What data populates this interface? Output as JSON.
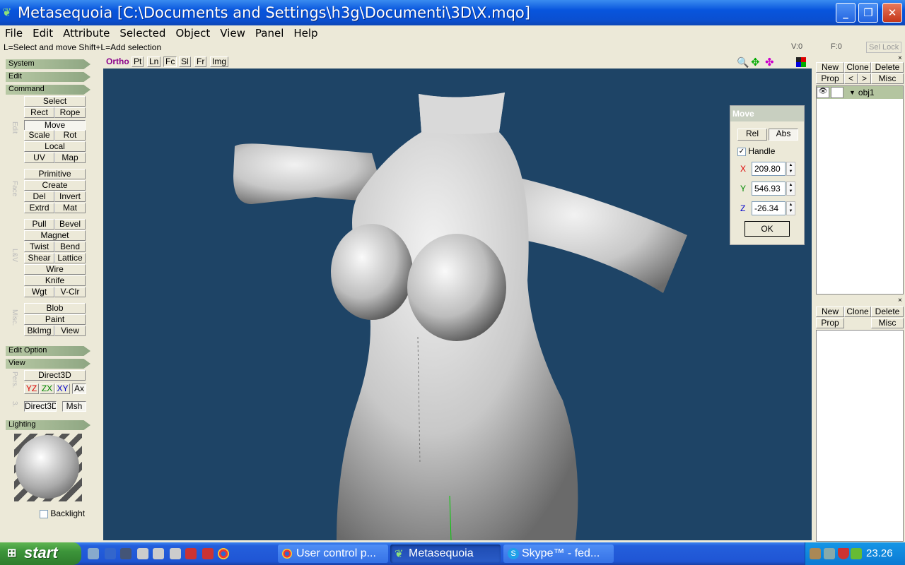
{
  "window": {
    "title": "Metasequoia [C:\\Documents and Settings\\h3g\\Documenti\\3D\\X.mqo]",
    "app_icon": "leaf-icon",
    "controls": [
      "_",
      "❐",
      "✕"
    ]
  },
  "menu": [
    "File",
    "Edit",
    "Attribute",
    "Selected",
    "Object",
    "View",
    "Panel",
    "Help"
  ],
  "hint": "L=Select and move  Shift+L=Add selection",
  "status": {
    "v": "V:0",
    "f": "F:0",
    "sel_lock": "Sel Lock"
  },
  "left": {
    "sections": {
      "system": "System",
      "edit": "Edit",
      "command": "Command",
      "edit_option": "Edit Option",
      "view": "View",
      "lighting": "Lighting"
    },
    "group_labels": {
      "edit": "Edit",
      "face": "Face",
      "lv": "L&V",
      "misc": "Misc.",
      "pers": "Pers.",
      "three": "3."
    },
    "cmd": {
      "select": "Select",
      "rect": "Rect",
      "rope": "Rope",
      "move": "Move",
      "scale": "Scale",
      "rot": "Rot",
      "local": "Local",
      "uv": "UV",
      "map": "Map",
      "primitive": "Primitive",
      "create": "Create",
      "del": "Del",
      "invert": "Invert",
      "extrd": "Extrd",
      "mat": "Mat",
      "pull": "Pull",
      "bevel": "Bevel",
      "magnet": "Magnet",
      "twist": "Twist",
      "bend": "Bend",
      "shear": "Shear",
      "lattice": "Lattice",
      "wire": "Wire",
      "knife": "Knife",
      "wgt": "Wgt",
      "vclr": "V-Clr",
      "blob": "Blob",
      "paint": "Paint",
      "bkimg": "BkImg",
      "view": "View"
    },
    "view": {
      "direct3d": "Direct3D",
      "yz": "YZ",
      "zx": "ZX",
      "xy": "XY",
      "ax": "Ax",
      "direct3d2": "Direct3D",
      "msh": "Msh"
    },
    "backlight": "Backlight"
  },
  "viewport": {
    "ortho": "Ortho",
    "buttons": [
      "Pt",
      "Ln",
      "Fc",
      "Sl",
      "Fr",
      "Img"
    ],
    "bg": "#1e4466"
  },
  "move_dialog": {
    "title": "Move",
    "rel": "Rel",
    "abs": "Abs",
    "handle": "Handle",
    "x_label": "X",
    "y_label": "Y",
    "z_label": "Z",
    "x": "209.80",
    "y": "546.93",
    "z": "-26.34",
    "ok": "OK"
  },
  "right": {
    "new": "New",
    "clone": "Clone",
    "delete": "Delete",
    "prop": "Prop",
    "prev": "<",
    "next": ">",
    "misc": "Misc",
    "object": "obj1",
    "new2": "New",
    "clone2": "Clone",
    "delete2": "Delete",
    "prop2": "Prop",
    "misc2": "Misc"
  },
  "taskbar": {
    "start": "start",
    "tasks": [
      "User control p...",
      "Metasequoia",
      "Skype™ - fed..."
    ],
    "clock": "23.26"
  }
}
